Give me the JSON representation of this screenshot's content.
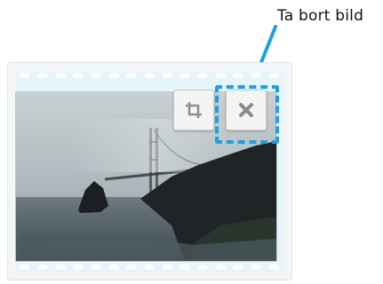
{
  "callout": {
    "label": "Ta bort bild",
    "color": "#1ba1e2"
  },
  "image_card": {
    "photo_subject": "golden-gate-bridge-in-fog",
    "actions": {
      "crop": {
        "icon": "crop-icon"
      },
      "remove": {
        "icon": "close-icon",
        "highlighted": true
      }
    }
  }
}
